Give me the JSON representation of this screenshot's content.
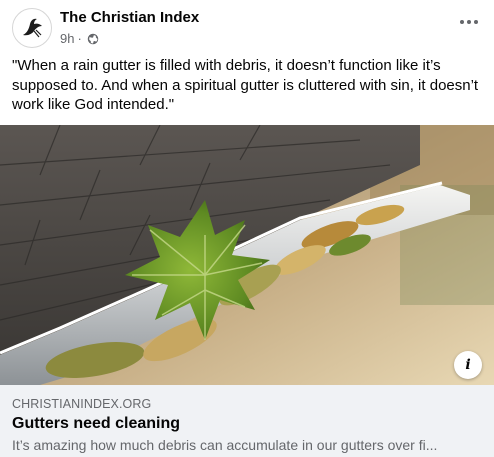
{
  "post": {
    "page_name": "The Christian Index",
    "time": "9h",
    "separator": "·",
    "audience_icon": "globe-icon",
    "more_icon": "more-options-icon",
    "text": "\"When a rain gutter is filled with debris, it doesn’t function like it’s supposed to. And when a spiritual gutter is cluttered with sin, it doesn’t work like God intended.\""
  },
  "link_preview": {
    "image_description_icon": "info-icon",
    "info_label": "i",
    "domain": "CHRISTIANINDEX.ORG",
    "title": "Gutters need cleaning",
    "description": "It’s amazing how much debris can accumulate in our gutters over fi..."
  },
  "colors": {
    "secondary_text": "#65676b",
    "primary_text": "#050505",
    "footer_bg": "#f0f2f5"
  }
}
